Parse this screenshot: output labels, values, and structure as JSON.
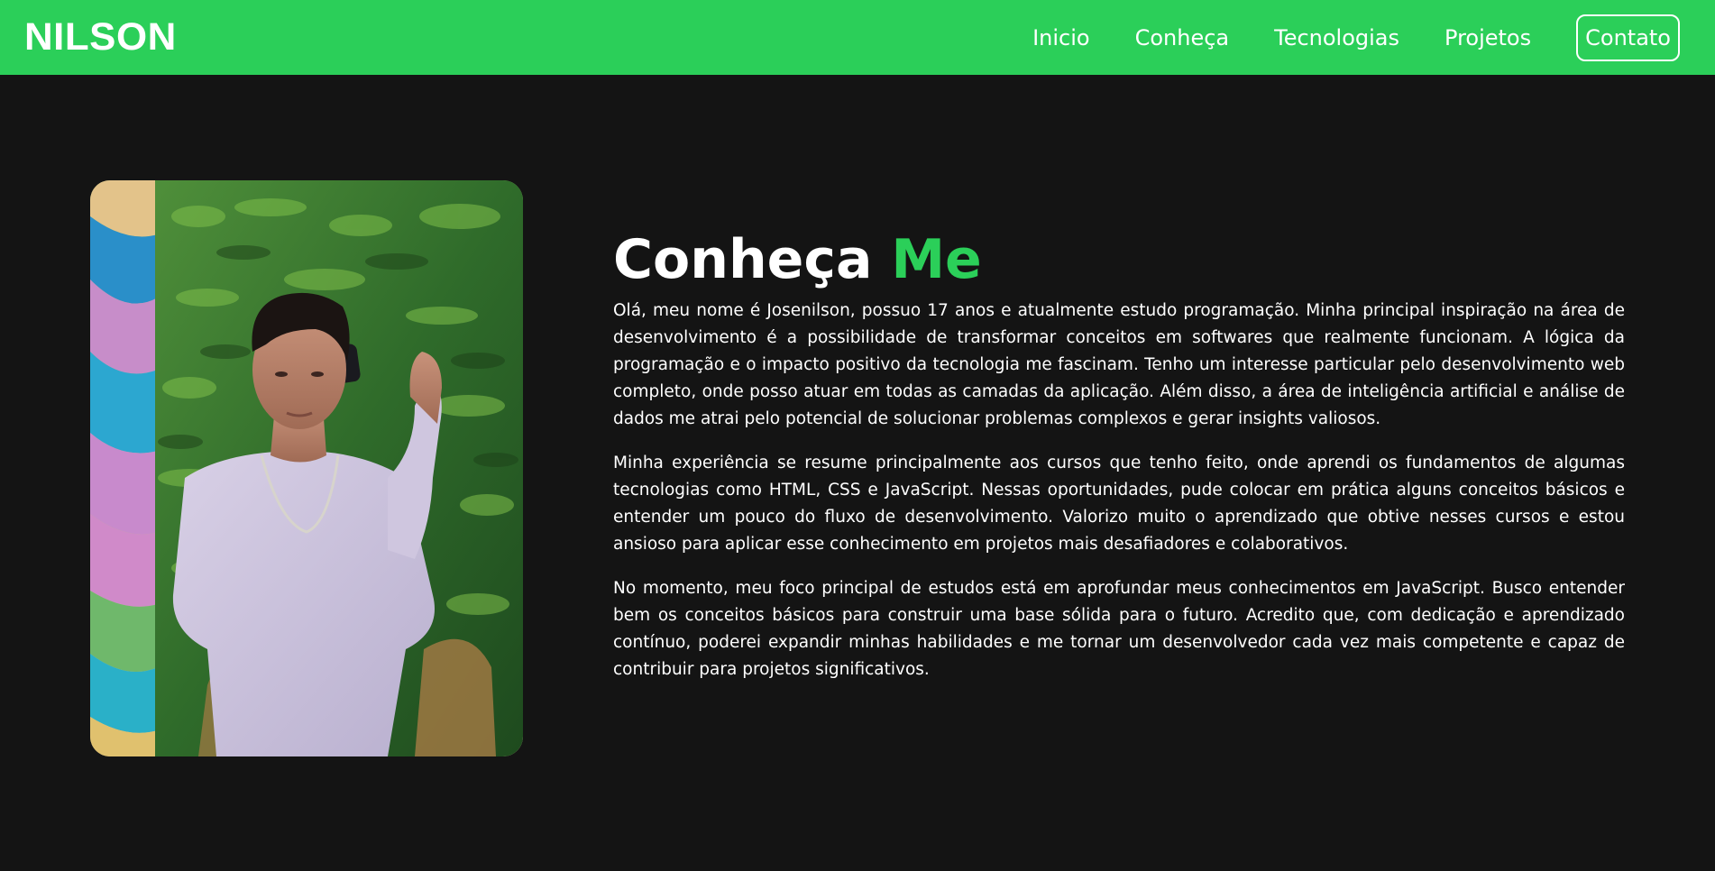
{
  "header": {
    "logo": "NILSON",
    "nav": [
      {
        "label": "Inicio"
      },
      {
        "label": "Conheça"
      },
      {
        "label": "Tecnologias"
      },
      {
        "label": "Projetos"
      },
      {
        "label": "Contato"
      }
    ]
  },
  "about": {
    "title_main": "Conheça",
    "title_accent": "Me",
    "paragraphs": [
      "Olá, meu nome é Josenilson, possuo 17 anos e atualmente estudo programação. Minha principal inspiração na área de desenvolvimento é a possibilidade de transformar conceitos em softwares que realmente funcionam. A lógica da programação e o impacto positivo da tecnologia me fascinam. Tenho um interesse particular pelo desenvolvimento web completo, onde posso atuar em todas as camadas da aplicação. Além disso, a área de inteligência artificial e análise de dados me atrai pelo potencial de solucionar problemas complexos e gerar insights valiosos.",
      "Minha experiência se resume principalmente aos cursos que tenho feito, onde aprendi os fundamentos de algumas tecnologias como HTML, CSS e JavaScript. Nessas oportunidades, pude colocar em prática alguns conceitos básicos e entender um pouco do fluxo de desenvolvimento. Valorizo muito o aprendizado que obtive nesses cursos e estou ansioso para aplicar esse conhecimento em projetos mais desafiadores e colaborativos.",
      "No momento, meu foco principal de estudos está em aprofundar meus conhecimentos em JavaScript. Busco entender bem os conceitos básicos para construir uma base sólida para o futuro. Acredito que, com dedicação e aprendizado contínuo, poderei expandir minhas habilidades e me tornar um desenvolvedor cada vez mais competente e capaz de contribuir para projetos significativos."
    ]
  },
  "colors": {
    "brand_green": "#2bcf59",
    "background": "#141414",
    "text": "#ffffff"
  }
}
